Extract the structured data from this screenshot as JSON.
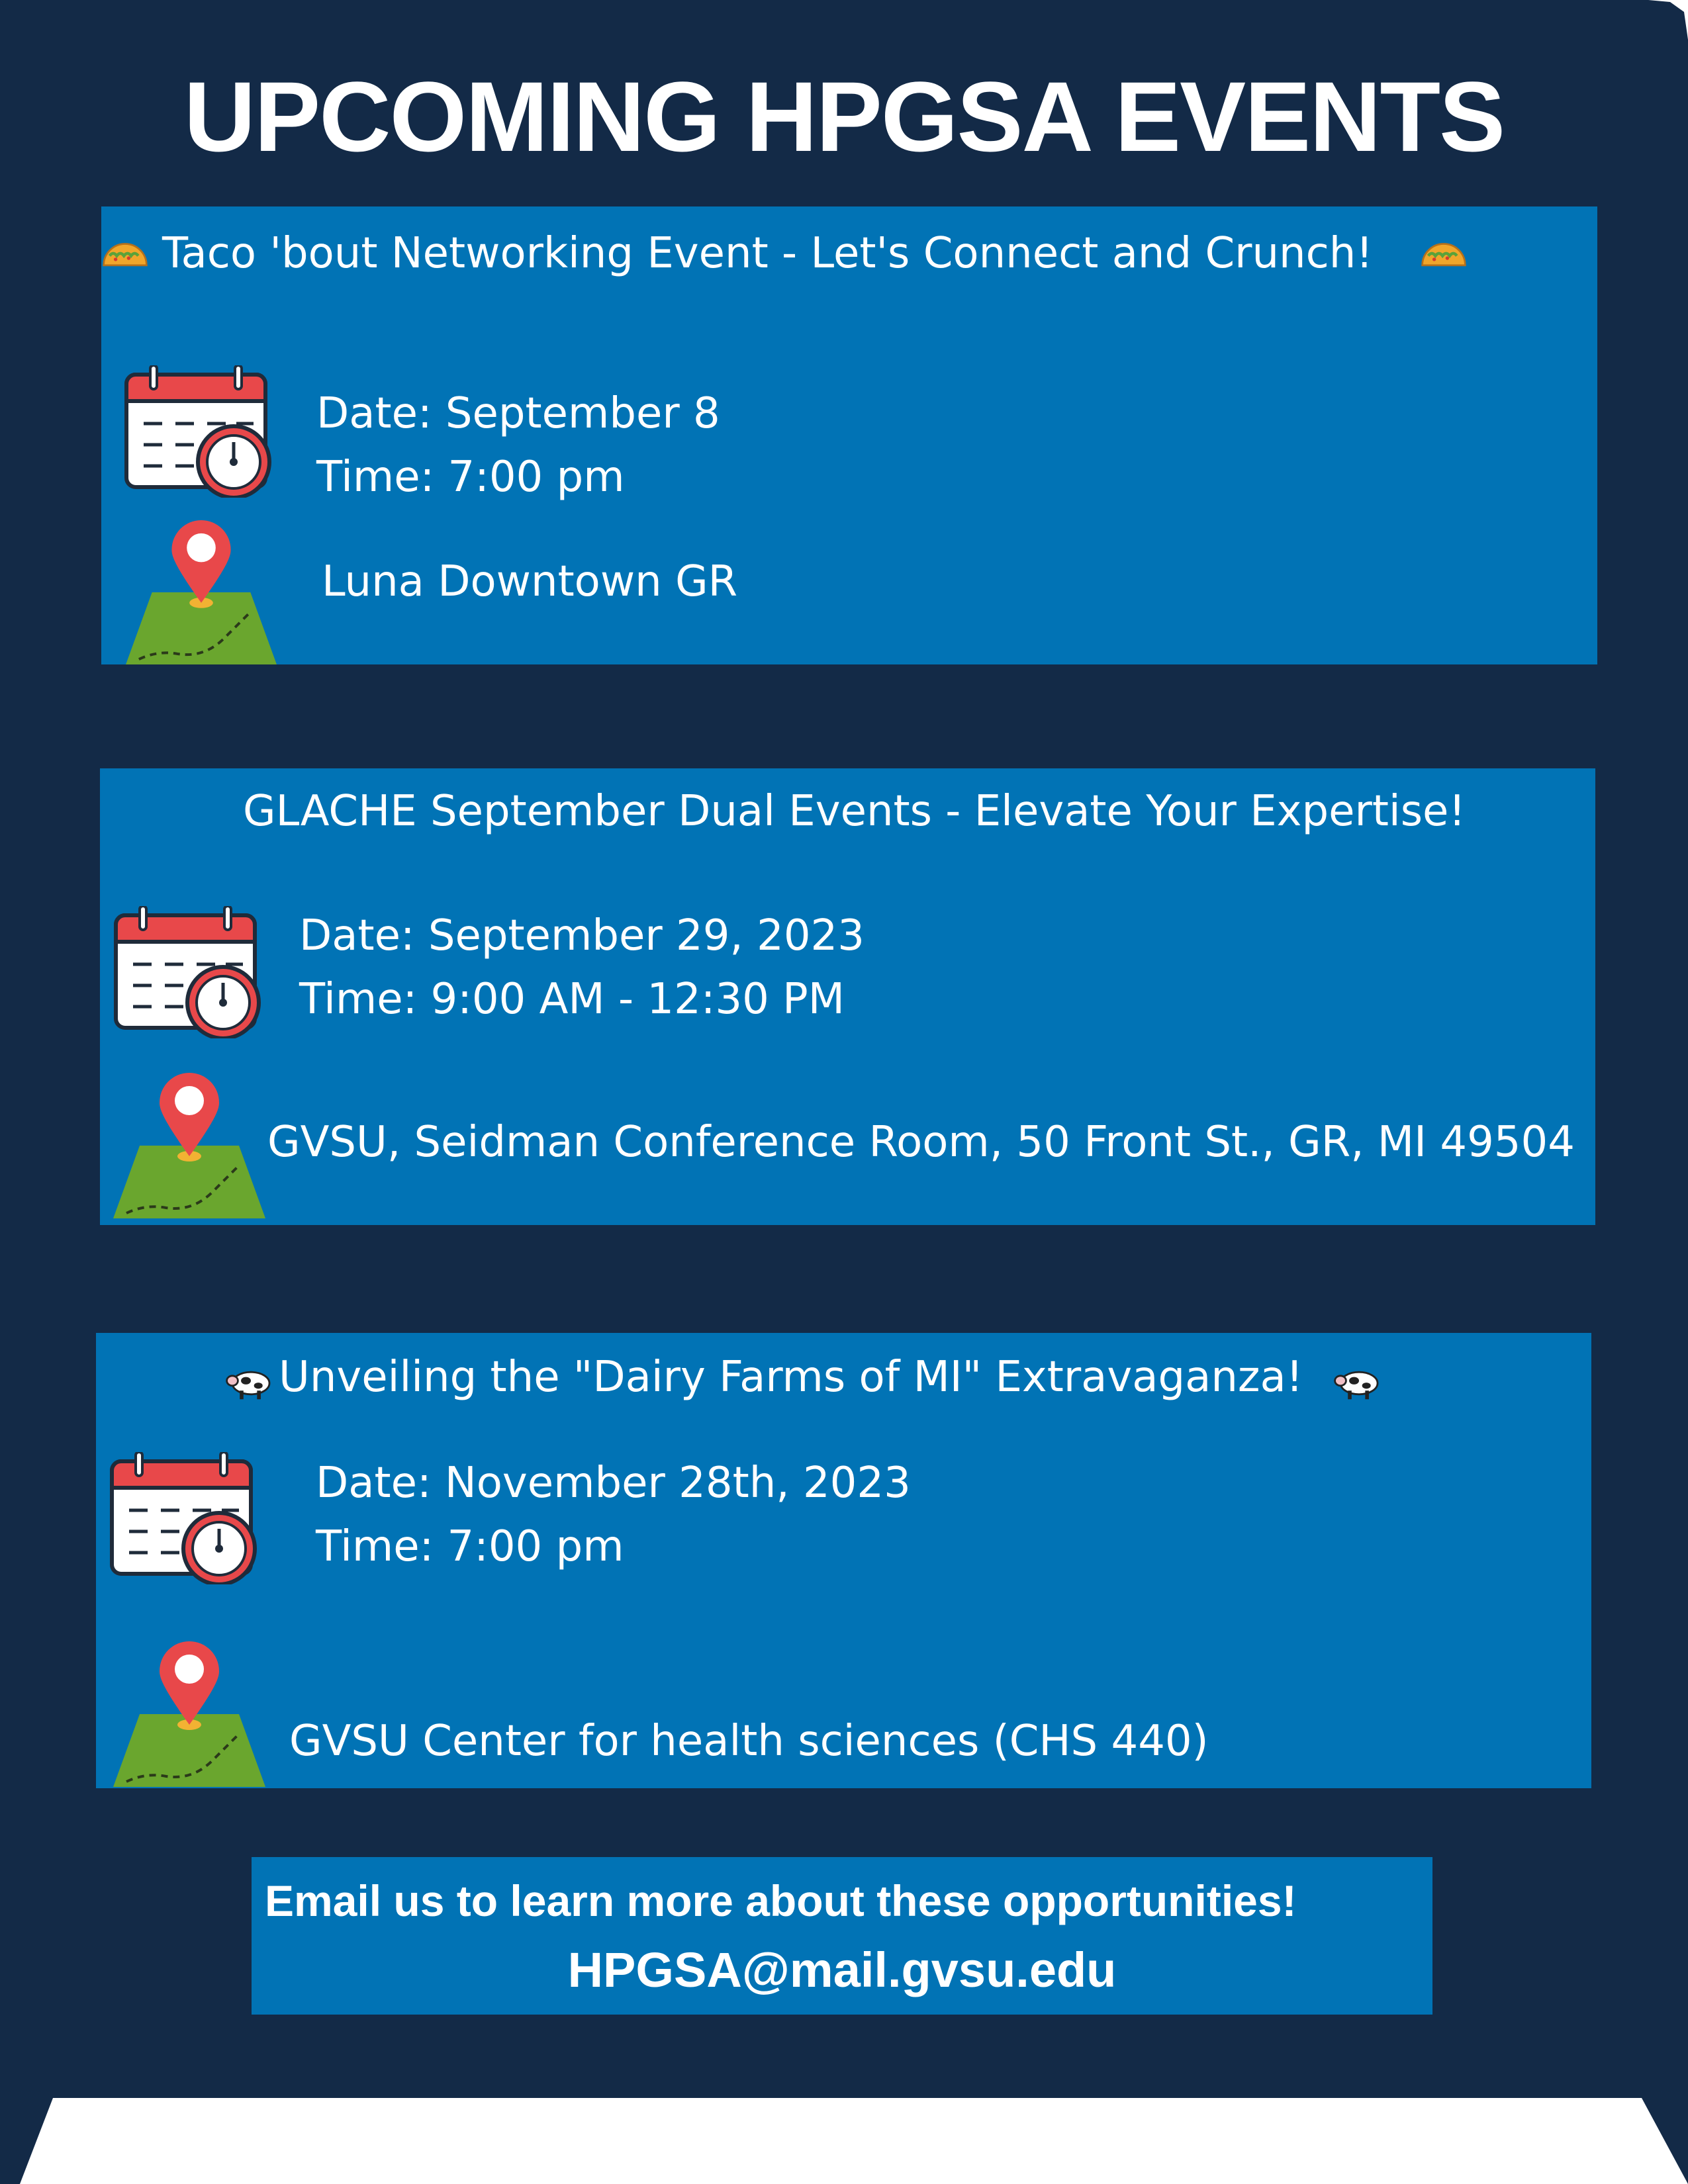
{
  "title": "UPCOMING HPGSA EVENTS",
  "events": [
    {
      "title": "Taco 'bout Networking Event - Let's Connect and Crunch!",
      "emoji": "taco-icon",
      "date": "Date: September 8",
      "time": "Time: 7:00 pm",
      "location": "Luna Downtown GR"
    },
    {
      "title": "GLACHE September Dual Events - Elevate Your Expertise!",
      "date": "Date: September 29, 2023",
      "time": "Time: 9:00 AM - 12:30 PM",
      "location": "GVSU, Seidman Conference Room, 50 Front St., GR, MI 49504"
    },
    {
      "title": "Unveiling the \"Dairy Farms of MI\" Extravaganza!",
      "emoji": "cow-icon",
      "date": "Date: November 28th, 2023",
      "time": "Time: 7:00 pm",
      "location": "GVSU Center for health sciences (CHS 440)"
    }
  ],
  "contact": {
    "line1": "Email us to learn more about these opportunities!",
    "email": "HPGSA@mail.gvsu.edu"
  },
  "colors": {
    "background": "#132a47",
    "card": "#0173b5",
    "text": "#ffffff"
  }
}
